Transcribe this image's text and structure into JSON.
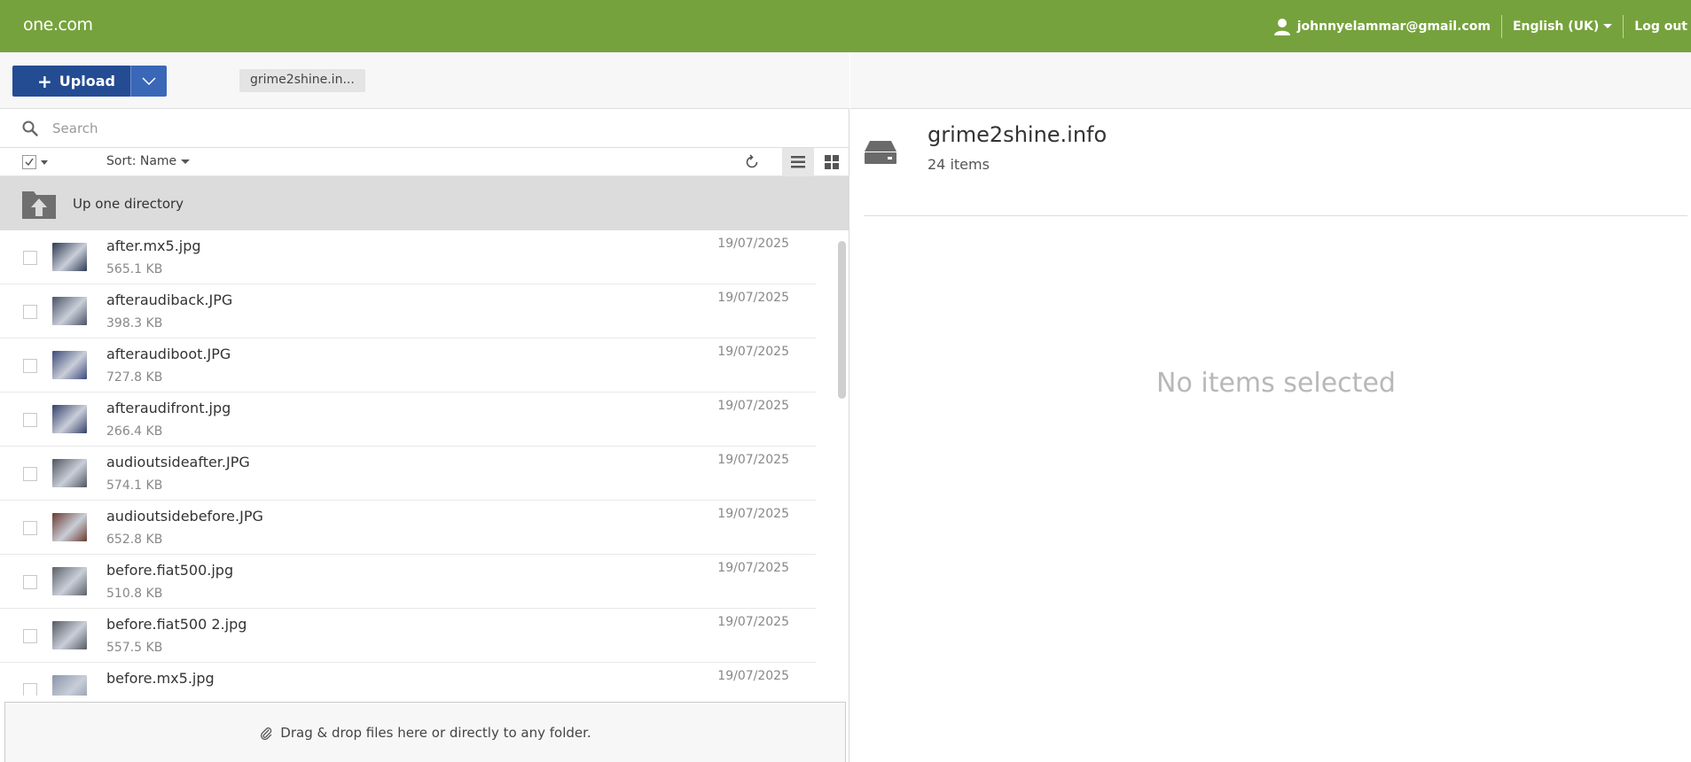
{
  "header": {
    "logo": "one.com",
    "user_email": "johnnyelammar@gmail.com",
    "language": "English (UK)",
    "logout": "Log out",
    "brand_color": "#76a23d"
  },
  "toolbar": {
    "upload_label": "Upload",
    "breadcrumb": "grime2shine.in..."
  },
  "search": {
    "placeholder": "Search",
    "value": ""
  },
  "sortbar": {
    "sort_label": "Sort: Name"
  },
  "updir": {
    "label": "Up one directory"
  },
  "files": [
    {
      "name": "after.mx5.jpg",
      "size": "565.1 KB",
      "date": "19/07/2025",
      "thumb": "#2d3a52"
    },
    {
      "name": "afteraudiback.JPG",
      "size": "398.3 KB",
      "date": "19/07/2025",
      "thumb": "#4a5266"
    },
    {
      "name": "afteraudiboot.JPG",
      "size": "727.8 KB",
      "date": "19/07/2025",
      "thumb": "#3c4a7a"
    },
    {
      "name": "afteraudifront.jpg",
      "size": "266.4 KB",
      "date": "19/07/2025",
      "thumb": "#34406a"
    },
    {
      "name": "audioutsideafter.JPG",
      "size": "574.1 KB",
      "date": "19/07/2025",
      "thumb": "#505660"
    },
    {
      "name": "audioutsidebefore.JPG",
      "size": "652.8 KB",
      "date": "19/07/2025",
      "thumb": "#6a3a30"
    },
    {
      "name": "before.fiat500.jpg",
      "size": "510.8 KB",
      "date": "19/07/2025",
      "thumb": "#5c6068"
    },
    {
      "name": "before.fiat500 2.jpg",
      "size": "557.5 KB",
      "date": "19/07/2025",
      "thumb": "#565a62"
    },
    {
      "name": "before.mx5.jpg",
      "size": "",
      "date": "19/07/2025",
      "thumb": "#8a96aa"
    }
  ],
  "dropzone": {
    "text": "Drag & drop files here or directly to any folder."
  },
  "details": {
    "folder_name": "grime2shine.info",
    "item_count": "24 items",
    "empty_text": "No items selected"
  }
}
